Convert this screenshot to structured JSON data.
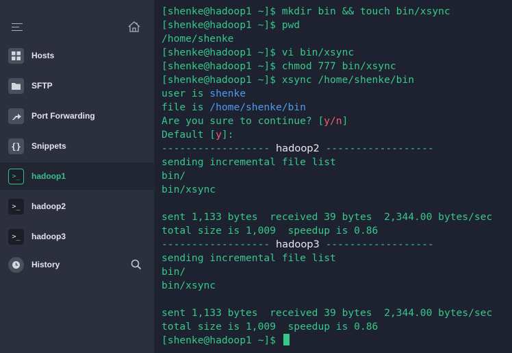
{
  "sidebar": {
    "menu_icon": "hamburger-icon",
    "home_icon": "home-icon",
    "items": [
      {
        "label": "Hosts",
        "icon": "server-grid-icon"
      },
      {
        "label": "SFTP",
        "icon": "folder-icon"
      },
      {
        "label": "Port Forwarding",
        "icon": "arrow-forward-icon"
      },
      {
        "label": "Snippets",
        "icon": "braces-icon"
      },
      {
        "label": "hadoop1",
        "icon": "terminal-icon",
        "active": true
      },
      {
        "label": "hadoop2",
        "icon": "terminal-icon"
      },
      {
        "label": "hadoop3",
        "icon": "terminal-icon"
      },
      {
        "label": "History",
        "icon": "clock-icon"
      }
    ],
    "search_icon": "search-icon",
    "accent_color": "#36c08c"
  },
  "terminal": {
    "lines": [
      [
        {
          "t": "[shenke@hadoop1 ~]$ mkdir bin && touch bin/xsync",
          "c": "g"
        }
      ],
      [
        {
          "t": "[shenke@hadoop1 ~]$ pwd",
          "c": "g"
        }
      ],
      [
        {
          "t": "/home/shenke",
          "c": "g"
        }
      ],
      [
        {
          "t": "[shenke@hadoop1 ~]$ vi bin/xsync",
          "c": "g"
        }
      ],
      [
        {
          "t": "[shenke@hadoop1 ~]$ chmod 777 bin/xsync",
          "c": "g"
        }
      ],
      [
        {
          "t": "[shenke@hadoop1 ~]$ xsync /home/shenke/bin",
          "c": "g"
        }
      ],
      [
        {
          "t": "user is ",
          "c": "g"
        },
        {
          "t": "shenke",
          "c": "b"
        }
      ],
      [
        {
          "t": "file is ",
          "c": "g"
        },
        {
          "t": "/home/shenke/bin",
          "c": "b"
        }
      ],
      [
        {
          "t": "Are you sure to continue? [",
          "c": "g"
        },
        {
          "t": "y/n",
          "c": "r"
        },
        {
          "t": "]",
          "c": "g"
        }
      ],
      [
        {
          "t": "Default [",
          "c": "g"
        },
        {
          "t": "y",
          "c": "r"
        },
        {
          "t": "]:",
          "c": "g"
        }
      ],
      [
        {
          "t": "------------------ ",
          "c": "g"
        },
        {
          "t": "hadoop2",
          "c": "w"
        },
        {
          "t": " ------------------",
          "c": "g"
        }
      ],
      [
        {
          "t": "sending incremental file list",
          "c": "g"
        }
      ],
      [
        {
          "t": "bin/",
          "c": "g"
        }
      ],
      [
        {
          "t": "bin/xsync",
          "c": "g"
        }
      ],
      [
        {
          "t": "",
          "c": "g"
        }
      ],
      [
        {
          "t": "sent 1,133 bytes  received 39 bytes  2,344.00 bytes/sec",
          "c": "g"
        }
      ],
      [
        {
          "t": "total size is 1,009  speedup is 0.86",
          "c": "g"
        }
      ],
      [
        {
          "t": "------------------ ",
          "c": "g"
        },
        {
          "t": "hadoop3",
          "c": "w"
        },
        {
          "t": " ------------------",
          "c": "g"
        }
      ],
      [
        {
          "t": "sending incremental file list",
          "c": "g"
        }
      ],
      [
        {
          "t": "bin/",
          "c": "g"
        }
      ],
      [
        {
          "t": "bin/xsync",
          "c": "g"
        }
      ],
      [
        {
          "t": "",
          "c": "g"
        }
      ],
      [
        {
          "t": "sent 1,133 bytes  received 39 bytes  2,344.00 bytes/sec",
          "c": "g"
        }
      ],
      [
        {
          "t": "total size is 1,009  speedup is 0.86",
          "c": "g"
        }
      ]
    ],
    "prompt": "[shenke@hadoop1 ~]$ "
  }
}
